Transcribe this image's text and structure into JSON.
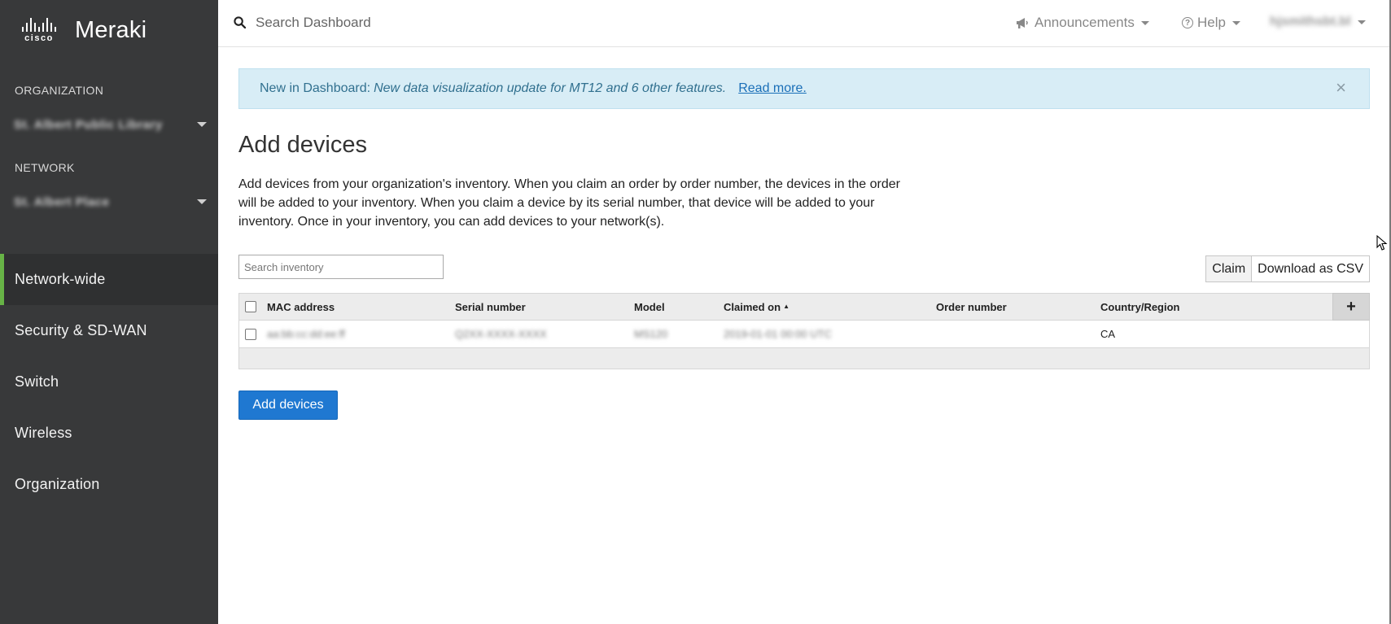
{
  "brand": {
    "cisco": "cisco",
    "product": "Meraki"
  },
  "sidebar": {
    "organization_label": "ORGANIZATION",
    "organization_value": "St. Albert Public Library",
    "network_label": "NETWORK",
    "network_value": "St. Albert Place",
    "items": [
      {
        "label": "Network-wide",
        "active": true
      },
      {
        "label": "Security & SD-WAN",
        "active": false
      },
      {
        "label": "Switch",
        "active": false
      },
      {
        "label": "Wireless",
        "active": false
      },
      {
        "label": "Organization",
        "active": false
      }
    ],
    "accent_color": "#67b346"
  },
  "topbar": {
    "search_placeholder": "Search Dashboard",
    "announcements_label": "Announcements",
    "help_label": "Help",
    "user_label": "hjsmithsbt.bl"
  },
  "banner": {
    "prefix": "New in Dashboard:",
    "message": "New data visualization update for MT12 and 6 other features.",
    "link": "Read more.",
    "close": "×"
  },
  "main": {
    "title": "Add devices",
    "description": "Add devices from your organization's inventory. When you claim an order by order number, the devices in the order will be added to your inventory. When you claim a device by its serial number, that device will be added to your inventory. Once in your inventory, you can add devices to your network(s).",
    "inventory_search_placeholder": "Search inventory",
    "claim_label": "Claim",
    "download_label": "Download as CSV",
    "add_devices_label": "Add devices"
  },
  "table": {
    "columns": [
      "MAC address",
      "Serial number",
      "Model",
      "Claimed on",
      "Order number",
      "Country/Region"
    ],
    "sort_indicator": "▲",
    "add_column": "+",
    "rows": [
      {
        "mac": "aa:bb:cc:dd:ee:ff",
        "serial": "Q2XX-XXXX-XXXX",
        "model": "MS120",
        "claimed_on": "2019-01-01 00:00 UTC",
        "order_number": "",
        "country": "CA"
      }
    ]
  },
  "colors": {
    "primary_button": "#1f78d1",
    "banner_bg": "#d8edf6",
    "sidebar_bg": "#38393a"
  }
}
